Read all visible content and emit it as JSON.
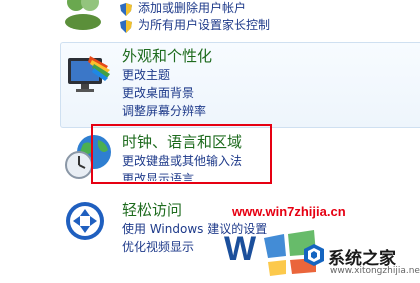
{
  "top": {
    "links": [
      "添加或删除用户帐户",
      "为所有用户设置家长控制"
    ]
  },
  "appearance": {
    "title": "外观和个性化",
    "links": [
      "更改主题",
      "更改桌面背景",
      "调整屏幕分辨率"
    ]
  },
  "clock": {
    "title": "时钟、语言和区域",
    "links": [
      "更改键盘或其他输入法",
      "更改显示语言"
    ]
  },
  "ease": {
    "title": "轻松访问",
    "links": [
      "使用 Windows 建议的设置",
      "优化视频显示"
    ]
  },
  "watermark": {
    "url": "www.win7zhijia.cn",
    "logo_text": "系统之家",
    "logo_url": "www.xitongzhijia.net"
  },
  "colors": {
    "highlight": "#e60012",
    "link": "#1e3a8a",
    "title": "#1e6b1e"
  },
  "icons": [
    "users-icon",
    "shield-icon",
    "display-personalize-icon",
    "globe-clock-icon",
    "ease-of-access-icon"
  ]
}
